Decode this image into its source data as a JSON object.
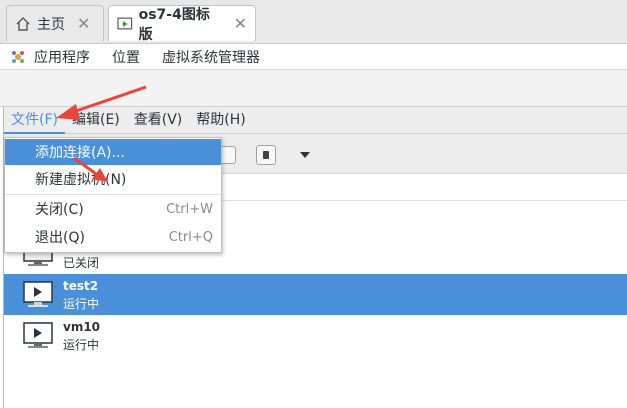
{
  "tabs": [
    {
      "label": "主页",
      "icon": "home-icon",
      "close": "✕",
      "active": false
    },
    {
      "label": "os7-4图标版",
      "icon": "vm-console-icon",
      "close": "✕",
      "active": true
    }
  ],
  "desktop_menu": {
    "items": [
      "应用程序",
      "位置",
      "虚拟系统管理器"
    ]
  },
  "app_menu": {
    "items": [
      "文件(F)",
      "编辑(E)",
      "查看(V)",
      "帮助(H)"
    ],
    "open_item": "文件(F)"
  },
  "file_menu": {
    "items": [
      {
        "label": "添加连接(A)...",
        "shortcut": "",
        "highlighted": true
      },
      {
        "label": "新建虚拟机(N)",
        "shortcut": "",
        "highlighted": false
      },
      {
        "label": "关闭(C)",
        "shortcut": "Ctrl+W",
        "highlighted": false
      },
      {
        "label": "退出(Q)",
        "shortcut": "Ctrl+Q",
        "highlighted": false
      }
    ]
  },
  "vm_list": {
    "rows": [
      {
        "name": "",
        "state": "已关闭",
        "selected": false
      },
      {
        "name": "test2",
        "state": "运行中",
        "selected": true
      },
      {
        "name": "vm10",
        "state": "运行中",
        "selected": false
      }
    ]
  },
  "colors": {
    "accent": "#4a90d9",
    "annotation_arrow": "#e8453c"
  }
}
